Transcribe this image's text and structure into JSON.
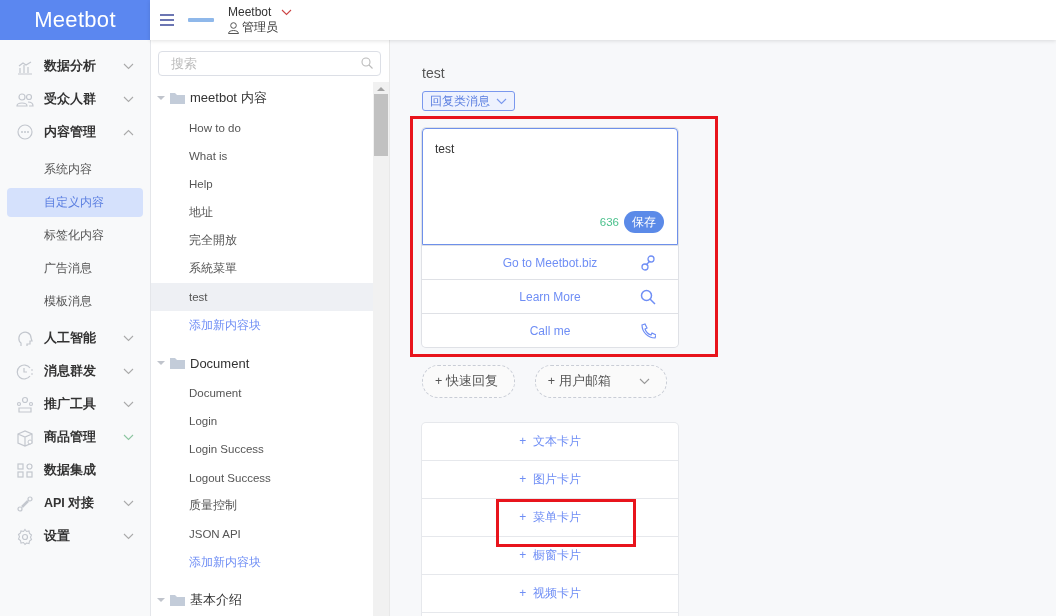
{
  "header": {
    "logo": "Meetbot",
    "account": "Meetbot",
    "role": "管理员"
  },
  "sidebar": {
    "items": [
      {
        "label": "数据分析",
        "expanded": false
      },
      {
        "label": "受众人群",
        "expanded": false
      },
      {
        "label": "内容管理",
        "expanded": true,
        "children": [
          {
            "label": "系统内容",
            "selected": false
          },
          {
            "label": "自定义内容",
            "selected": true
          },
          {
            "label": "标签化内容",
            "selected": false
          },
          {
            "label": "广告消息",
            "selected": false
          },
          {
            "label": "模板消息",
            "selected": false
          }
        ]
      },
      {
        "label": "人工智能",
        "expanded": false
      },
      {
        "label": "消息群发",
        "expanded": false
      },
      {
        "label": "推广工具",
        "expanded": false
      },
      {
        "label": "商品管理",
        "expanded": false
      },
      {
        "label": "数据集成"
      },
      {
        "label": "API 对接",
        "expanded": false
      },
      {
        "label": "设置",
        "expanded": false
      }
    ]
  },
  "tree": {
    "search_placeholder": "搜索",
    "folders": [
      {
        "label": "meetbot 内容",
        "expanded": true,
        "add_link": "添加新内容块",
        "children": [
          {
            "label": "How to do",
            "selected": false
          },
          {
            "label": "What is",
            "selected": false
          },
          {
            "label": "Help",
            "selected": false
          },
          {
            "label": "地址",
            "selected": false
          },
          {
            "label": "完全開放",
            "selected": false
          },
          {
            "label": "系統菜單",
            "selected": false
          },
          {
            "label": "test",
            "selected": true
          }
        ]
      },
      {
        "label": "Document",
        "expanded": true,
        "add_link": "添加新内容块",
        "children": [
          {
            "label": "Document",
            "selected": false
          },
          {
            "label": "Login",
            "selected": false
          },
          {
            "label": "Login Success",
            "selected": false
          },
          {
            "label": "Logout Success",
            "selected": false
          },
          {
            "label": "质量控制",
            "selected": false
          },
          {
            "label": "JSON API",
            "selected": false
          }
        ]
      },
      {
        "label": "基本介绍",
        "expanded": true
      }
    ]
  },
  "editor": {
    "title": "test",
    "type_select": "回复类消息",
    "reply": {
      "text": "test",
      "count": "636",
      "save": "保存",
      "highlighted": true,
      "buttons": [
        {
          "label": "Go to Meetbot.biz",
          "kind": "link"
        },
        {
          "label": "Learn More",
          "kind": "search"
        },
        {
          "label": "Call me",
          "kind": "phone"
        }
      ]
    },
    "quick_actions": [
      {
        "label": "+ 快速回复",
        "dropdown": false
      },
      {
        "label": "+ 用户邮箱",
        "dropdown": true
      }
    ],
    "add_cards": [
      {
        "label": "+  文本卡片",
        "highlighted": false
      },
      {
        "label": "+  图片卡片",
        "highlighted": false
      },
      {
        "label": "+  菜单卡片",
        "highlighted": true
      },
      {
        "label": "+  橱窗卡片",
        "highlighted": false
      },
      {
        "label": "+  视频卡片",
        "highlighted": false
      }
    ]
  }
}
